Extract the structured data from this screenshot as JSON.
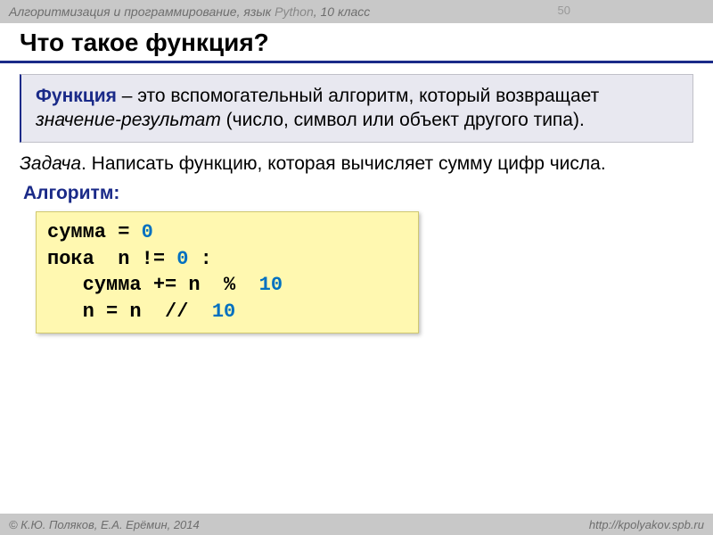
{
  "header": {
    "course": "Алгоритмизация и программирование, язык",
    "lang": "Python",
    "grade": ", 10 класс",
    "page": "50"
  },
  "title": "Что такое функция?",
  "definition": {
    "term": "Функция",
    "rest1": " – это вспомогательный алгоритм, который возвращает ",
    "italic": "значение-результат",
    "rest2": " (число, символ или объект другого типа)."
  },
  "task": {
    "label": "Задача",
    "text": ". Написать функцию, которая вычисляет сумму цифр числа."
  },
  "algorithm_label": "Алгоритм:",
  "code": {
    "l1a": "сумма = ",
    "l1b": "0",
    "l2a": "пока  n != ",
    "l2b": "0",
    "l2c": " :",
    "l3a": "   сумма += n  %  ",
    "l3b": "10",
    "l4a": "   n = n  //  ",
    "l4b": "10"
  },
  "footer": {
    "authors": "© К.Ю. Поляков, Е.А. Ерёмин, 2014",
    "url": "http://kpolyakov.spb.ru"
  }
}
